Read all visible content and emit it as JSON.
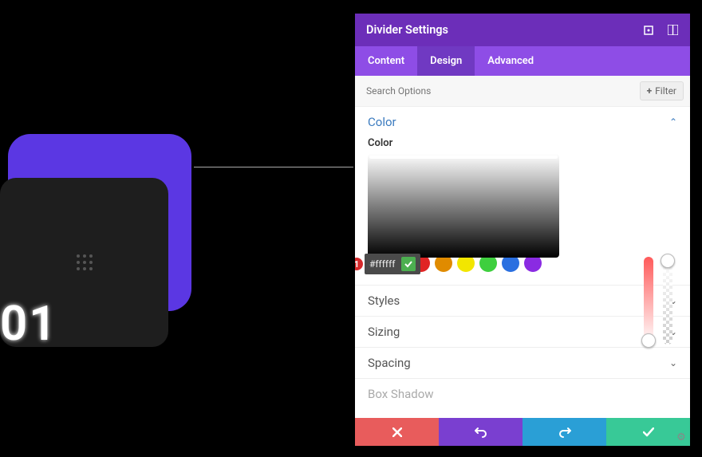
{
  "canvas": {
    "number_text": "01"
  },
  "panel": {
    "title": "Divider Settings",
    "tabs": {
      "content": "Content",
      "design": "Design",
      "advanced": "Advanced",
      "active": "design"
    },
    "search_placeholder": "Search Options",
    "filter_label": "Filter",
    "sections": {
      "color": {
        "title": "Color",
        "sub_label": "Color",
        "expanded": true
      },
      "styles": {
        "title": "Styles",
        "expanded": false
      },
      "sizing": {
        "title": "Sizing",
        "expanded": false
      },
      "spacing": {
        "title": "Spacing",
        "expanded": false
      },
      "box_shadow": {
        "title": "Box Shadow",
        "expanded": false
      }
    },
    "color_picker": {
      "hex_value": "#ffffff",
      "swatches": [
        "#000000",
        "#ffffff",
        "#e02424",
        "#e08b00",
        "#f2e600",
        "#3ecf3e",
        "#2a6fe0",
        "#8a2be2"
      ]
    },
    "callout_number": "1"
  }
}
